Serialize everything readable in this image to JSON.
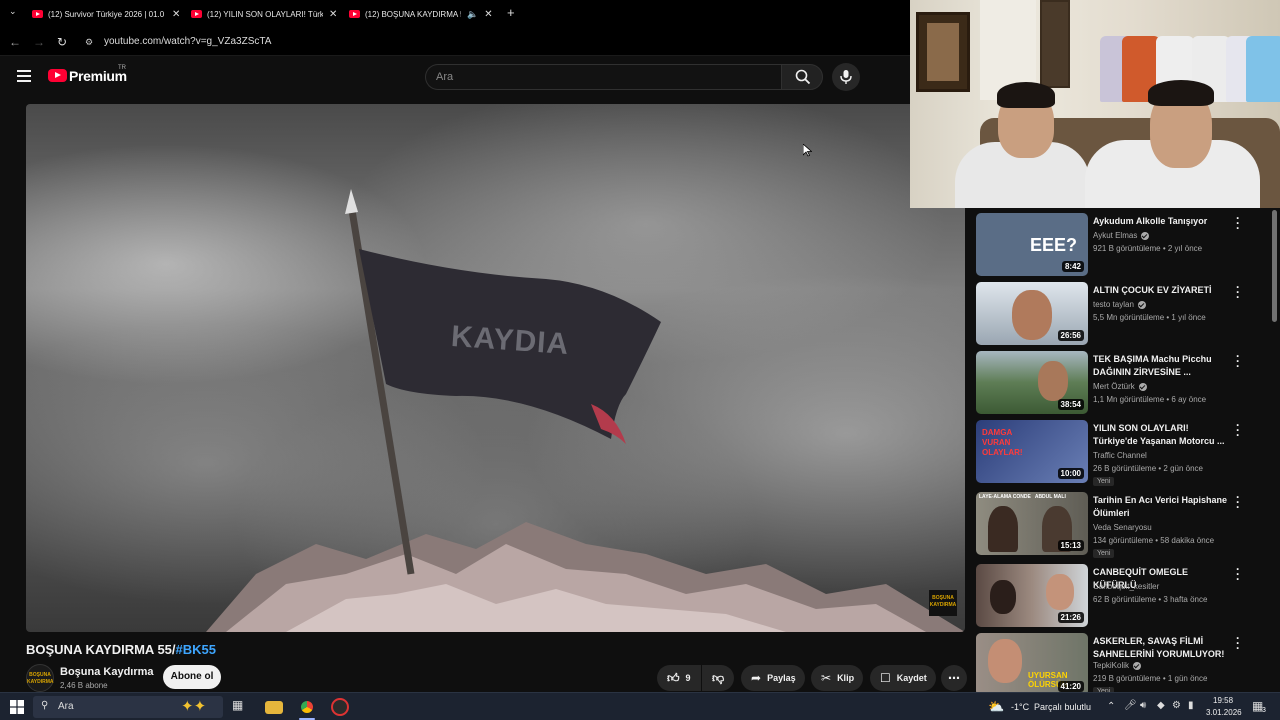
{
  "browser": {
    "tabs": [
      {
        "title": "(12) Survivor Türkiye 2026 | 01.0"
      },
      {
        "title": "(12) YILIN SON OLAYLARI! Türk"
      },
      {
        "title": "(12) BOŞUNA KAYDIRMA 55"
      }
    ],
    "url": "youtube.com/watch?v=g_VZa3ZScTA"
  },
  "yt": {
    "brand": "Premium",
    "region": "TR",
    "search_placeholder": "Ara"
  },
  "video": {
    "flag_text": "KAYDIA",
    "watermark": "BOŞUNA KAYDIRMA",
    "title": "BOŞUNA KAYDIRMA 55/",
    "hashtag": "#BK55",
    "channel": "Boşuna Kaydırma",
    "subscribers": "2,46 B abone",
    "subscribe_label": "Abone ol",
    "like_count": "9",
    "share_label": "Paylaş",
    "clip_label": "Klip",
    "save_label": "Kaydet"
  },
  "sidebar": {
    "items": [
      {
        "title": "Aykudum Alkolle Tanışıyor",
        "channel": "Aykut Elmas",
        "verified": true,
        "meta": "921 B görüntüleme • 2 yıl önce",
        "duration": "8:42",
        "badge": "",
        "thumb_text": "EEE?",
        "thumb_color": "#5a6d86"
      },
      {
        "title": "ALTIN ÇOCUK EV ZİYARETİ",
        "channel": "testo taylan",
        "verified": true,
        "meta": "5,5 Mn görüntüleme • 1 yıl önce",
        "duration": "26:56",
        "badge": "",
        "thumb_text": "",
        "thumb_color": "#c8d2dc"
      },
      {
        "title": "TEK BAŞIMA Machu Picchu DAĞININ ZİRVESİNE ...",
        "channel": "Mert Öztürk",
        "verified": true,
        "meta": "1,1 Mn görüntüleme • 6 ay önce",
        "duration": "38:54",
        "badge": "",
        "thumb_text": "",
        "thumb_color": "#4e7a4a"
      },
      {
        "title": "YILIN SON OLAYLARI! Türkiye'de Yaşanan Motorcu ...",
        "channel": "Traffic Channel",
        "verified": false,
        "meta": "26 B görüntüleme • 2 gün önce",
        "duration": "10:00",
        "badge": "Yeni",
        "thumb_text": "DAMGA VURAN OLAYLAR!",
        "thumb_color": "#3a4f8c"
      },
      {
        "title": "Tarihin En Acı Verici Hapishane Ölümleri",
        "channel": "Veda Senaryosu",
        "verified": false,
        "meta": "134 görüntüleme • 58 dakika önce",
        "duration": "15:13",
        "badge": "Yeni",
        "thumb_text": "LAYE-ALAMA CONDE   ABDUL MALI",
        "thumb_color": "#6d6b60"
      },
      {
        "title": "CANBEQUİT OMEGLE KÜFÜRLÜ",
        "channel": "Canbequit_kesitler",
        "verified": false,
        "meta": "62 B görüntüleme • 3 hafta önce",
        "duration": "21:26",
        "badge": "",
        "thumb_text": "",
        "thumb_color": "#8a7a72"
      },
      {
        "title": "ASKERLER, SAVAŞ FİLMİ SAHNELERİNİ YORUMLUYOR!",
        "channel": "TepkiKolik",
        "verified": true,
        "meta": "219 B görüntüleme • 1 gün önce",
        "duration": "41:20",
        "badge": "Yeni",
        "thumb_text": "UYURSAN ÖLÜRSÜN",
        "thumb_color": "#7c7d74"
      }
    ]
  },
  "taskbar": {
    "search_label": "Ara",
    "temperature": "-1°C",
    "weather": "Parçalı bulutlu",
    "time": "19:58",
    "date": "3.01.2026",
    "notifications": "3"
  },
  "colors": {
    "youtube_red": "#ff0033",
    "link_blue": "#3ea6ff",
    "background": "#0f0f0f"
  }
}
